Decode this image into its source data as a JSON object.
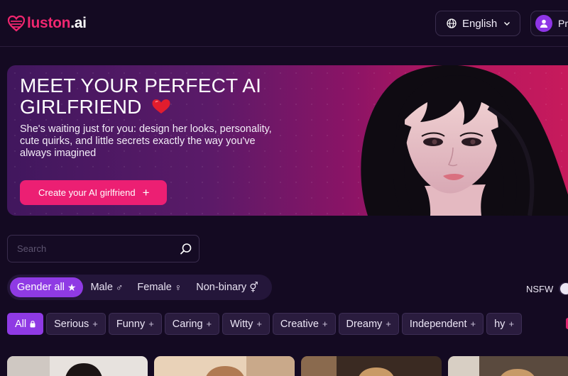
{
  "header": {
    "logo": {
      "brand": "luston",
      "tld": ".ai"
    },
    "language": {
      "label": "English",
      "icon": "globe-icon"
    },
    "profile": {
      "label": "Profile",
      "icon": "user-icon"
    }
  },
  "hero": {
    "title_line1": "MEET YOUR PERFECT AI",
    "title_line2": "GIRLFRIEND",
    "subtitle": "She's waiting just for you: design her looks, personality, cute quirks, and little secrets exactly the way you've always imagined",
    "cta_label": "Create your AI girlfriend",
    "cta_icon": "+"
  },
  "search": {
    "placeholder": "Search"
  },
  "gender_tabs": [
    {
      "label": "Gender all",
      "symbol": "★",
      "active": true
    },
    {
      "label": "Male",
      "symbol": "♂",
      "active": false
    },
    {
      "label": "Female",
      "symbol": "♀",
      "active": false
    },
    {
      "label": "Non-binary",
      "symbol": "⚥",
      "active": false
    }
  ],
  "nsfw": {
    "label": "NSFW",
    "enabled": false
  },
  "categories": [
    {
      "label": "All",
      "active": true
    },
    {
      "label": "Serious",
      "suffix": "+"
    },
    {
      "label": "Funny",
      "suffix": "+"
    },
    {
      "label": "Caring",
      "suffix": "+"
    },
    {
      "label": "Witty",
      "suffix": "+"
    },
    {
      "label": "Creative",
      "suffix": "+"
    },
    {
      "label": "Dreamy",
      "suffix": "+"
    },
    {
      "label": "Independent",
      "suffix": "+"
    },
    {
      "label": "hy",
      "suffix": "+"
    }
  ],
  "colors": {
    "accent_pink": "#ec1f73",
    "accent_purple": "#8f3ae4",
    "background": "#140a22"
  }
}
